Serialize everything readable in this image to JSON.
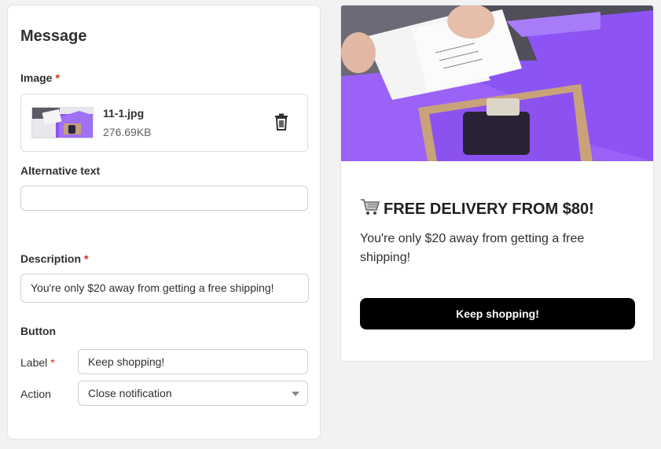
{
  "form": {
    "title": "Message",
    "image_label": "Image",
    "required_mark": "*",
    "image": {
      "filename": "11-1.jpg",
      "size": "276.69KB"
    },
    "alt_label": "Alternative text",
    "alt_value": "",
    "description_label": "Description",
    "description_value": "You're only $20 away from getting a free shipping!",
    "button_section": "Button",
    "label_label": "Label",
    "label_value": "Keep shopping!",
    "action_label": "Action",
    "action_value": "Close notification"
  },
  "preview": {
    "headline": "FREE DELIVERY FROM $80!",
    "headline_icon": "shopping-cart-icon",
    "description": "You're only $20 away from getting a free shipping!",
    "button": "Keep shopping!"
  },
  "colors": {
    "required": "#d72c0d",
    "cta_bg": "#000000",
    "accent_purple": "#8b5cf6"
  }
}
